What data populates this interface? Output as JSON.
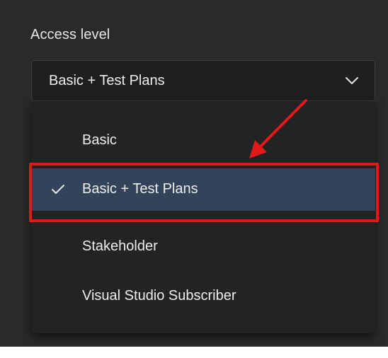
{
  "field": {
    "label": "Access level",
    "selected_value": "Basic + Test Plans"
  },
  "dropdown": {
    "options": [
      {
        "label": "Basic",
        "selected": false
      },
      {
        "label": "Basic + Test Plans",
        "selected": true
      },
      {
        "label": "Stakeholder",
        "selected": false
      },
      {
        "label": "Visual Studio Subscriber",
        "selected": false
      }
    ]
  },
  "icons": {
    "toggle": "chevron-down-icon",
    "selected_marker": "checkmark-icon"
  },
  "colors": {
    "panel_bg": "#2b2a29",
    "selected_bg": "#33445a",
    "annotation_red": "#e11919"
  }
}
